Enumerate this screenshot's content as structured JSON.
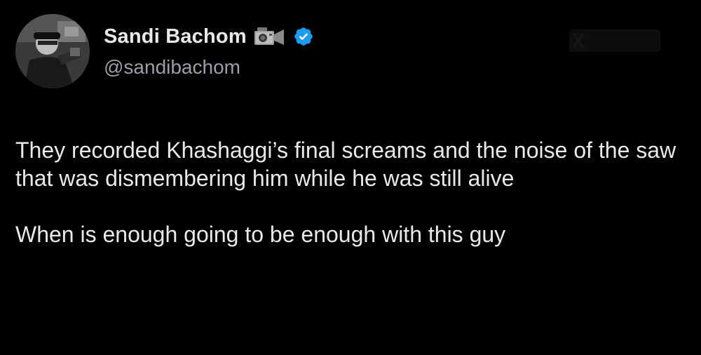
{
  "author": {
    "display_name": "Sandi Bachom",
    "handle": "@sandibachom",
    "avatar_icon": "profile-photo",
    "name_emoji_icon": "video-camera-icon",
    "verified_icon": "verified-badge-icon",
    "verified_color": "#1d9bf0"
  },
  "tweet": {
    "paragraphs": [
      "They recorded Khashaggi’s final screams and the noise of the saw that was dismembering him while he was still alive",
      "When is enough going to be enough with this guy"
    ]
  },
  "colors": {
    "background": "#000000",
    "text_primary": "#e7e9ea",
    "text_secondary": "#9aa0a6"
  }
}
